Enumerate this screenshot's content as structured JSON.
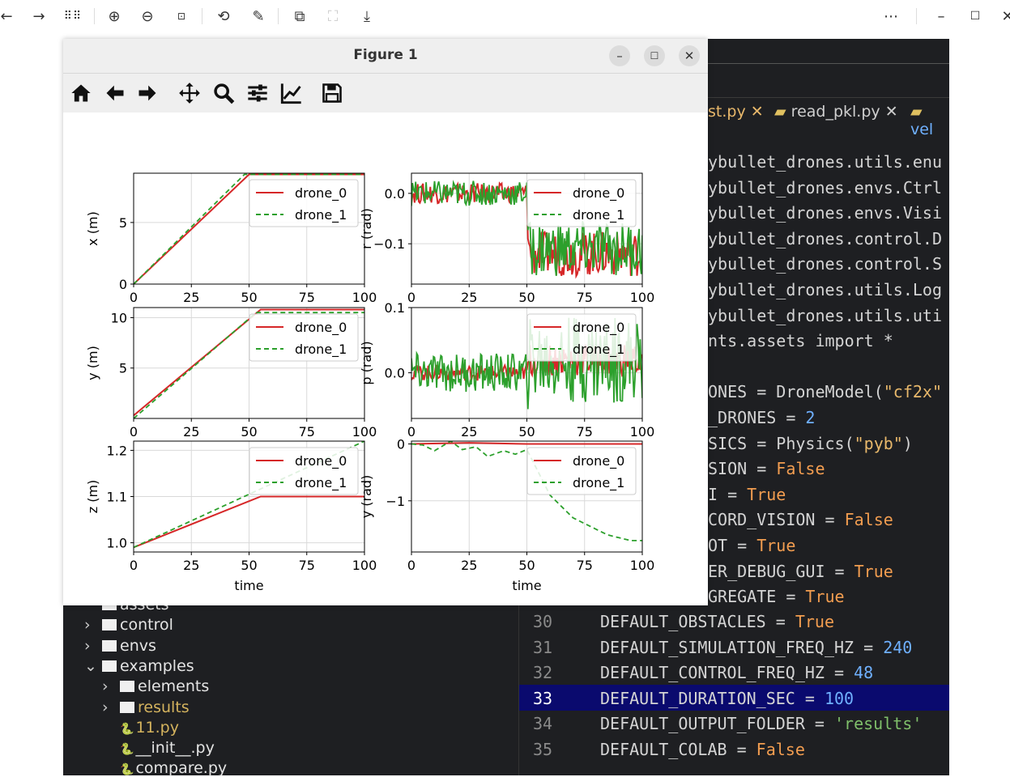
{
  "viewer": {
    "icons": [
      "arrow-left-icon",
      "arrow-right-icon",
      "grid-icon",
      "zoom-in-icon",
      "zoom-out-icon",
      "actual-size-icon",
      "rotate-icon",
      "edit-icon",
      "crop-icon",
      "fit-icon",
      "save-icon",
      "more-icon",
      "minimize-icon",
      "maximize-icon",
      "close-icon"
    ]
  },
  "editor": {
    "tabs": [
      "st.py",
      "read_pkl.py",
      "vel"
    ],
    "code": [
      "ybullet_drones.utils.enu",
      "ybullet_drones.envs.Ctrl",
      "ybullet_drones.envs.Visi",
      "ybullet_drones.control.D",
      "ybullet_drones.control.S",
      "ybullet_drones.utils.Log",
      "ybullet_drones.utils.uti",
      "nts.assets import *",
      "",
      "ONES = DroneModel(\"cf2x\"",
      "_DRONES = 2",
      "SICS = Physics(\"pyb\")",
      "SION = False",
      "I = True",
      "CORD_VISION = False",
      "OT = True",
      "ER_DEBUG_GUI = True",
      "GREGATE = True"
    ],
    "bottom_lines": [
      {
        "n": "30",
        "code": "DEFAULT_OBSTACLES = True"
      },
      {
        "n": "31",
        "code": "DEFAULT_SIMULATION_FREQ_HZ = 240"
      },
      {
        "n": "32",
        "code": "DEFAULT_CONTROL_FREQ_HZ = 48"
      },
      {
        "n": "33",
        "code": "DEFAULT_DURATION_SEC = 100"
      },
      {
        "n": "34",
        "code": "DEFAULT_OUTPUT_FOLDER = 'results'"
      },
      {
        "n": "35",
        "code": "DEFAULT_COLAB = False"
      }
    ],
    "highlighted_line": "33"
  },
  "tree": [
    {
      "label": "assets",
      "indent": 0,
      "type": "folder"
    },
    {
      "label": "control",
      "indent": 0,
      "type": "folder",
      "arrow": "›"
    },
    {
      "label": "envs",
      "indent": 0,
      "type": "folder",
      "arrow": "›"
    },
    {
      "label": "examples",
      "indent": 0,
      "type": "folder",
      "arrow": "⌄"
    },
    {
      "label": "elements",
      "indent": 1,
      "type": "folder",
      "arrow": "›"
    },
    {
      "label": "results",
      "indent": 1,
      "type": "folder",
      "arrow": "›"
    },
    {
      "label": "11.py",
      "indent": 1,
      "type": "file"
    },
    {
      "label": "__init__.py",
      "indent": 1,
      "type": "file"
    },
    {
      "label": "compare.py",
      "indent": 1,
      "type": "file"
    }
  ],
  "figure": {
    "title": "Figure 1",
    "tools": [
      "home-icon",
      "back-icon",
      "forward-icon",
      "pan-icon",
      "zoom-icon",
      "configure-icon",
      "edit-curves-icon",
      "save-icon"
    ]
  },
  "colors": {
    "drone_0": "#d62728",
    "drone_1": "#2ca02c",
    "highlight": "#0a0a6e"
  },
  "chart_data": [
    {
      "type": "line",
      "ylabel": "x (m)",
      "xlabel": "",
      "xlim": [
        0,
        100
      ],
      "ylim": [
        0,
        9
      ],
      "xticks": [
        0,
        25,
        50,
        75,
        100
      ],
      "yticks": [
        0,
        5
      ],
      "yticklabels": [
        "0",
        "5"
      ],
      "legend": [
        "drone_0",
        "drone_1"
      ],
      "series": [
        {
          "name": "drone_0",
          "x": [
            0,
            50,
            100
          ],
          "y": [
            0,
            8.9,
            8.9
          ]
        },
        {
          "name": "drone_1",
          "x": [
            0,
            48,
            100
          ],
          "y": [
            0,
            8.9,
            8.9
          ]
        }
      ]
    },
    {
      "type": "line",
      "ylabel": "r (rad)",
      "xlabel": "",
      "xlim": [
        0,
        100
      ],
      "ylim": [
        -0.18,
        0.04
      ],
      "xticks": [
        0,
        25,
        50,
        75,
        100
      ],
      "yticks": [
        0,
        -0.1
      ],
      "yticklabels": [
        "0.0",
        "−0.1"
      ],
      "legend": [
        "drone_0",
        "drone_1"
      ],
      "series": [
        {
          "name": "drone_0",
          "x": [
            0,
            50,
            51,
            100
          ],
          "y": [
            0.0,
            0.0,
            -0.12,
            -0.12
          ],
          "noise": 0.02
        },
        {
          "name": "drone_1",
          "x": [
            0,
            50,
            51,
            100
          ],
          "y": [
            0.0,
            0.0,
            -0.11,
            -0.11
          ],
          "noise": 0.025
        }
      ]
    },
    {
      "type": "line",
      "ylabel": "y (m)",
      "xlabel": "",
      "xlim": [
        0,
        100
      ],
      "ylim": [
        0,
        11
      ],
      "xticks": [
        0,
        25,
        50,
        75,
        100
      ],
      "yticks": [
        5,
        10
      ],
      "yticklabels": [
        "5",
        "10"
      ],
      "legend": [
        "drone_0",
        "drone_1"
      ],
      "series": [
        {
          "name": "drone_0",
          "x": [
            0,
            55,
            100
          ],
          "y": [
            0.3,
            10.8,
            10.8
          ]
        },
        {
          "name": "drone_1",
          "x": [
            0,
            53,
            100
          ],
          "y": [
            0.0,
            10.5,
            10.5
          ]
        }
      ]
    },
    {
      "type": "line",
      "ylabel": "p (rad)",
      "xlabel": "",
      "xlim": [
        0,
        100
      ],
      "ylim": [
        -0.07,
        0.1
      ],
      "xticks": [
        0,
        25,
        50,
        75,
        100
      ],
      "yticks": [
        0,
        0.1
      ],
      "yticklabels": [
        "0.0",
        "0.1"
      ],
      "legend": [
        "drone_0",
        "drone_1"
      ],
      "series": [
        {
          "name": "drone_0",
          "x": [
            0,
            50,
            51,
            100
          ],
          "y": [
            0.0,
            0.0,
            0.02,
            0.02
          ],
          "noise": 0.012
        },
        {
          "name": "drone_1",
          "x": [
            0,
            50,
            51,
            100
          ],
          "y": [
            0.0,
            0.0,
            0.02,
            0.02
          ],
          "noise": 0.03
        }
      ]
    },
    {
      "type": "line",
      "ylabel": "z (m)",
      "xlabel": "time",
      "xlim": [
        0,
        100
      ],
      "ylim": [
        0.98,
        1.22
      ],
      "xticks": [
        0,
        25,
        50,
        75,
        100
      ],
      "yticks": [
        1.0,
        1.1,
        1.2
      ],
      "yticklabels": [
        "1.0",
        "1.1",
        "1.2"
      ],
      "legend": [
        "drone_0",
        "drone_1"
      ],
      "series": [
        {
          "name": "drone_0",
          "x": [
            0,
            50,
            55,
            100
          ],
          "y": [
            0.99,
            1.09,
            1.1,
            1.1
          ]
        },
        {
          "name": "drone_1",
          "x": [
            0,
            100
          ],
          "y": [
            0.99,
            1.22
          ]
        }
      ]
    },
    {
      "type": "line",
      "ylabel": "y (rad)",
      "xlabel": "time",
      "xlim": [
        0,
        100
      ],
      "ylim": [
        -1.9,
        0.05
      ],
      "xticks": [
        0,
        25,
        50,
        75,
        100
      ],
      "yticks": [
        0,
        -1
      ],
      "yticklabels": [
        "0",
        "−1"
      ],
      "legend": [
        "drone_0",
        "drone_1"
      ],
      "series": [
        {
          "name": "drone_0",
          "x": [
            0,
            25,
            50,
            55,
            100
          ],
          "y": [
            0.0,
            0.02,
            0.0,
            0.0,
            0.0
          ]
        },
        {
          "name": "drone_1",
          "x": [
            0,
            5,
            10,
            17,
            22,
            28,
            33,
            40,
            45,
            50,
            55,
            60,
            65,
            70,
            75,
            80,
            85,
            90,
            95,
            100
          ],
          "y": [
            0.0,
            -0.02,
            -0.12,
            0.05,
            -0.1,
            -0.05,
            -0.22,
            -0.12,
            -0.18,
            -0.1,
            -0.5,
            -0.9,
            -1.1,
            -1.3,
            -1.4,
            -1.5,
            -1.6,
            -1.65,
            -1.7,
            -1.7
          ]
        }
      ]
    }
  ]
}
